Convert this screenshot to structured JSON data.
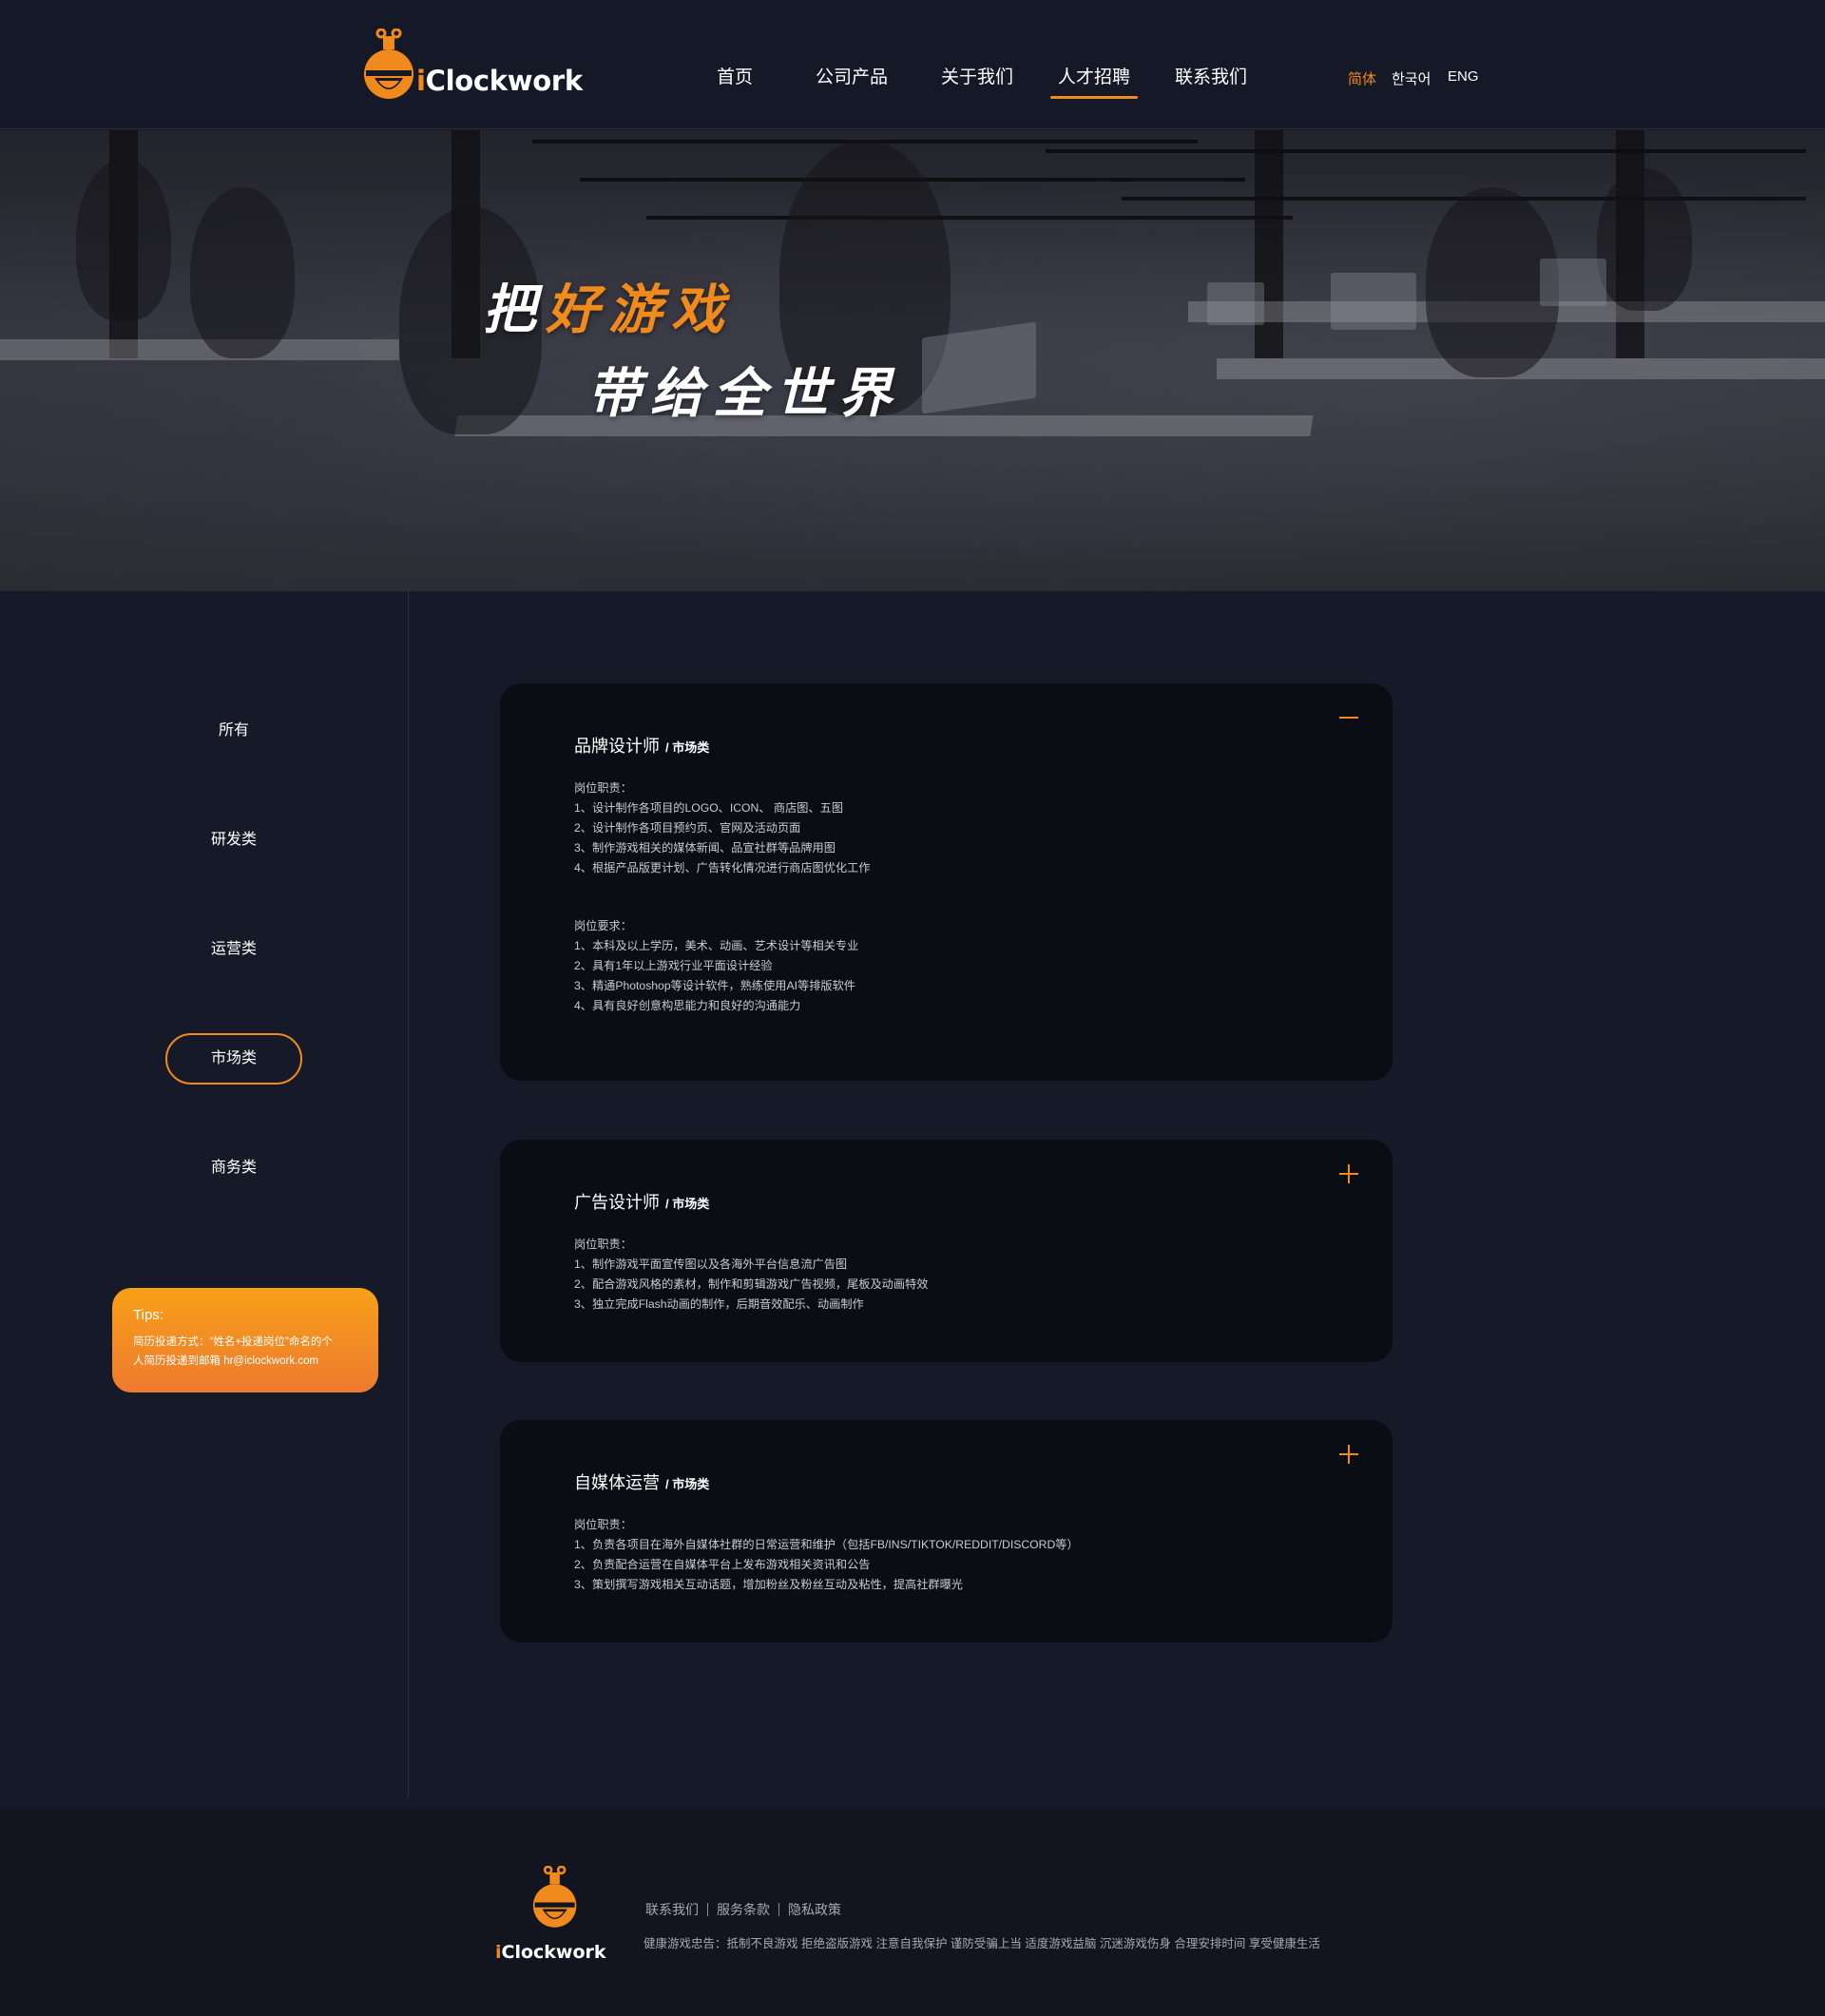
{
  "brand": {
    "logo_prefix": "i",
    "logo_rest": "Clockwork",
    "accent_color": "#f08a1d",
    "logo_icon": "robot-head-icon"
  },
  "nav": {
    "items": [
      {
        "label": "首页"
      },
      {
        "label": "公司产品"
      },
      {
        "label": "关于我们"
      },
      {
        "label": "人才招聘",
        "active": true
      },
      {
        "label": "联系我们"
      }
    ]
  },
  "languages": [
    {
      "label": "简体",
      "active": true
    },
    {
      "label": "한국어"
    },
    {
      "label": "ENG"
    }
  ],
  "hero": {
    "line1_prefix": "把",
    "line1_highlight": "好游戏",
    "line2": "带给全世界"
  },
  "categories": [
    {
      "label": "所有"
    },
    {
      "label": "研发类"
    },
    {
      "label": "运营类"
    },
    {
      "label": "市场类",
      "active": true
    },
    {
      "label": "商务类"
    }
  ],
  "tips": {
    "title": "Tips:",
    "line1": "简历投递方式：“姓名+投递岗位”命名的个",
    "line2": "人简历投递到邮箱 hr@iclockwork.com"
  },
  "jobs": [
    {
      "title": "品牌设计师",
      "category": "/ 市场类",
      "expanded": true,
      "toggle_icon": "minus-icon",
      "duties_title": "岗位职责：",
      "duties": [
        "1、设计制作各项目的LOGO、ICON、 商店图、五图",
        "2、设计制作各项目预约页、官网及活动页面",
        "3、制作游戏相关的媒体新闻、品宣社群等品牌用图",
        "4、根据产品版更计划、广告转化情况进行商店图优化工作"
      ],
      "requirements_title": "岗位要求：",
      "requirements": [
        "1、本科及以上学历，美术、动画、艺术设计等相关专业",
        "2、具有1年以上游戏行业平面设计经验",
        "3、精通Photoshop等设计软件，熟练使用AI等排版软件",
        "4、具有良好创意构思能力和良好的沟通能力"
      ]
    },
    {
      "title": "广告设计师",
      "category": "/ 市场类",
      "expanded": false,
      "toggle_icon": "plus-icon",
      "duties_title": "岗位职责：",
      "duties": [
        "1、制作游戏平面宣传图以及各海外平台信息流广告图",
        "2、配合游戏风格的素材，制作和剪辑游戏广告视频，尾板及动画特效",
        "3、独立完成Flash动画的制作，后期音效配乐、动画制作"
      ]
    },
    {
      "title": "自媒体运营",
      "category": "/ 市场类",
      "expanded": false,
      "toggle_icon": "plus-icon",
      "duties_title": "岗位职责：",
      "duties": [
        "1、负责各项目在海外自媒体社群的日常运营和维护（包括FB/INS/TIKTOK/REDDIT/DISCORD等）",
        "2、负责配合运营在自媒体平台上发布游戏相关资讯和公告",
        "3、策划撰写游戏相关互动话题，增加粉丝及粉丝互动及粘性，提高社群曝光"
      ]
    }
  ],
  "footer": {
    "links": [
      "联系我们",
      "服务条款",
      "隐私政策"
    ],
    "notice": "健康游戏忠告：抵制不良游戏 拒绝盗版游戏 注意自我保护 谨防受骗上当 适度游戏益脑 沉迷游戏伤身 合理安排时间 享受健康生活"
  }
}
